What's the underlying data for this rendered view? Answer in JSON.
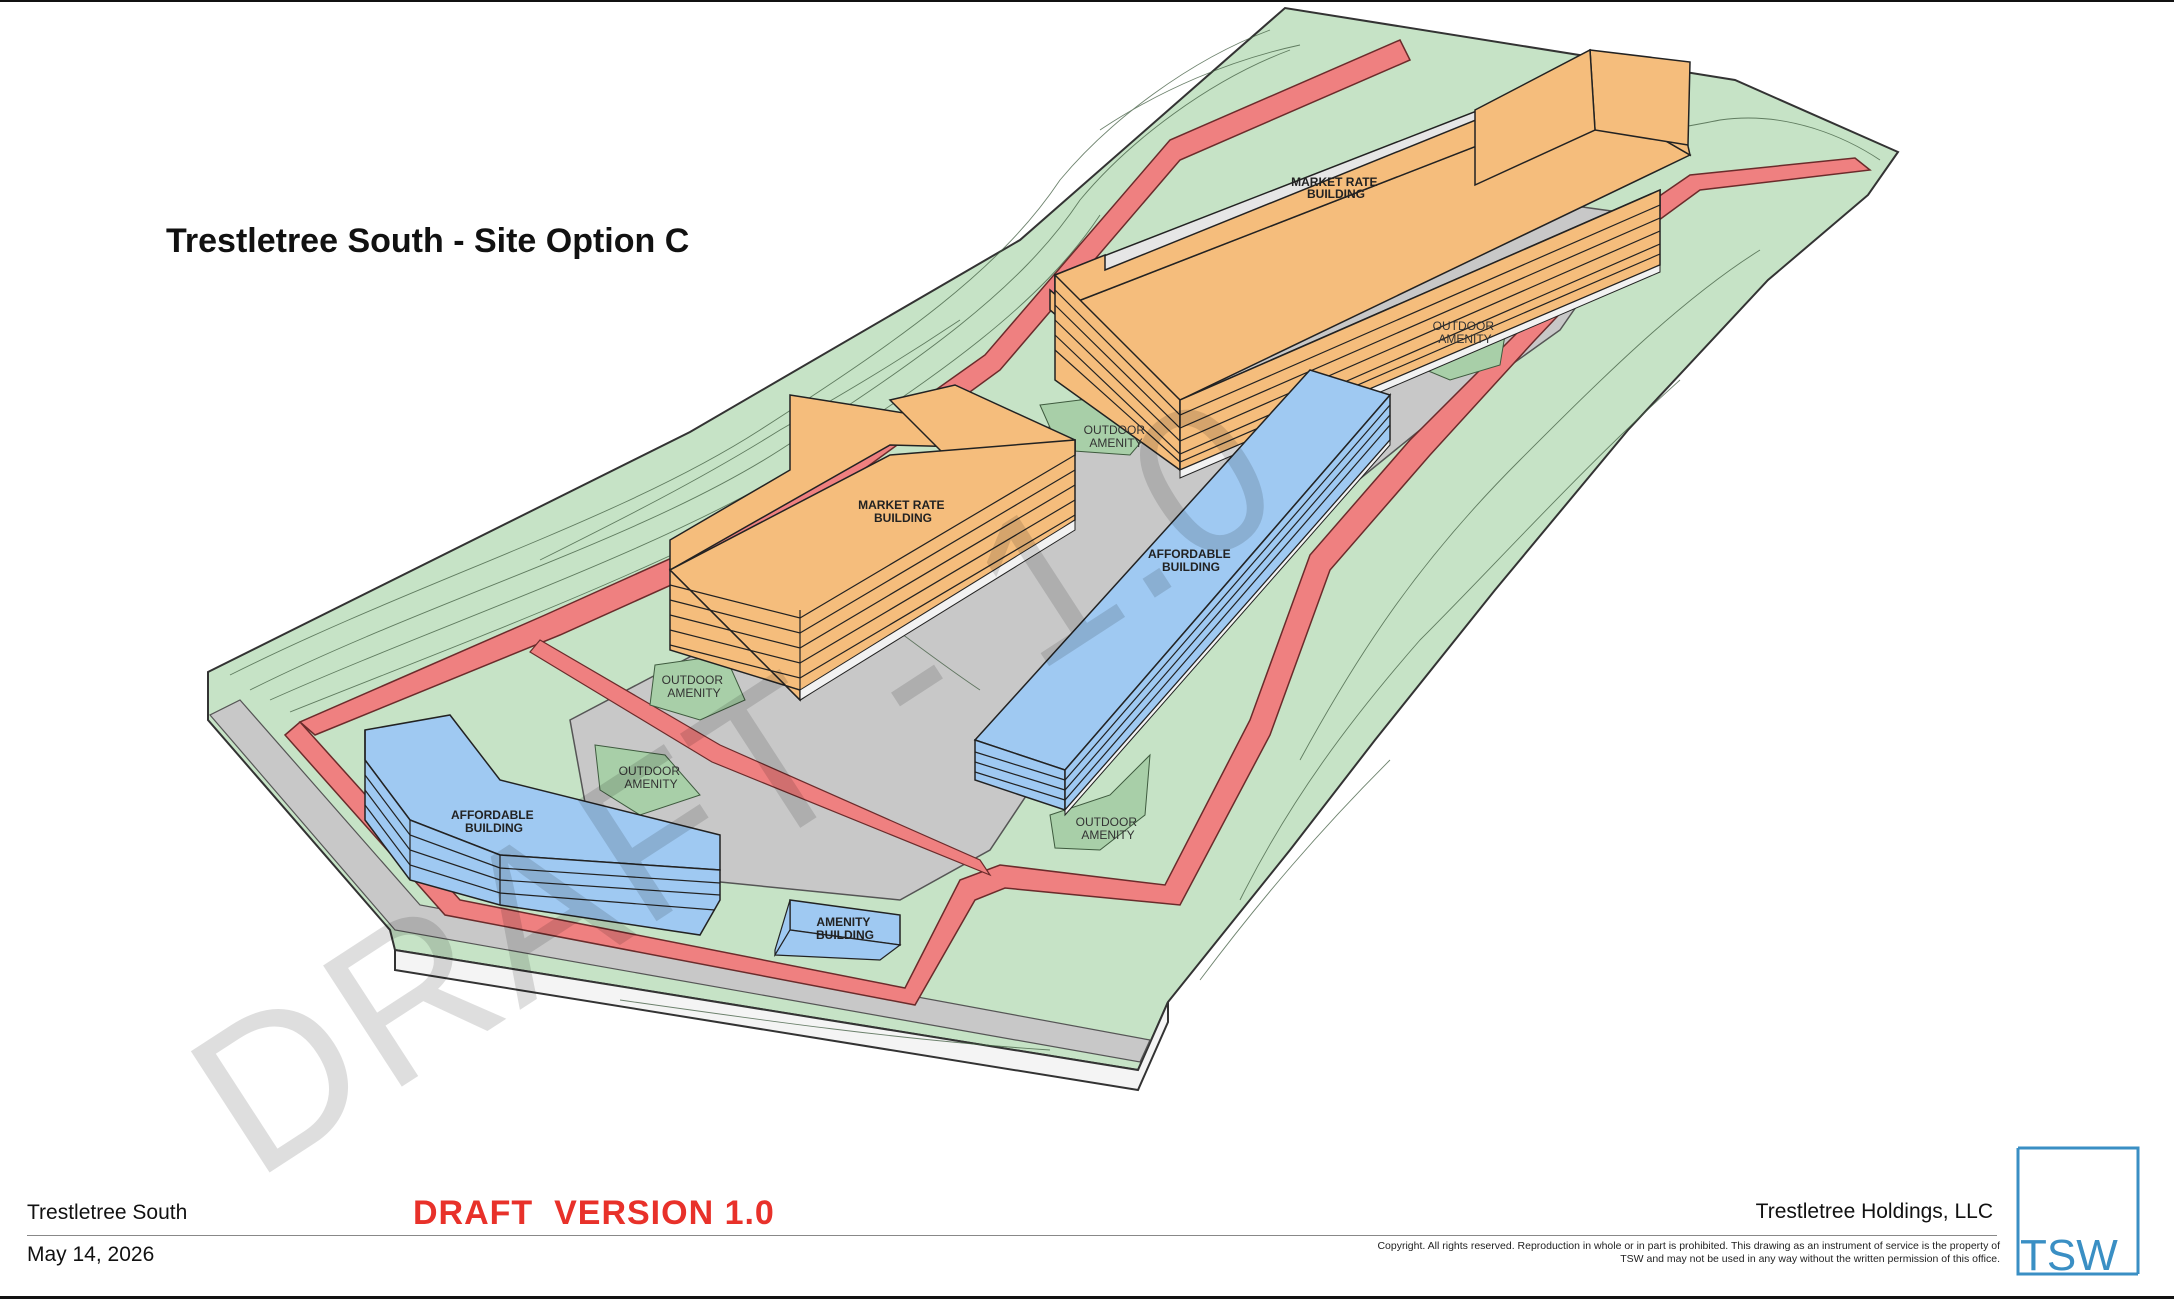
{
  "title": "Trestletree South - Site Option C",
  "watermark": "DRAFT - 1.0",
  "labels": {
    "market_rate_1": [
      "MARKET RATE",
      "BUILDING"
    ],
    "market_rate_2": [
      "MARKET RATE",
      "BUILDING"
    ],
    "affordable_1": [
      "AFFORDABLE",
      "BUILDING"
    ],
    "affordable_2": [
      "AFFORDABLE",
      "BUILDING"
    ],
    "amenity_building": [
      "AMENITY",
      "BUILDING"
    ],
    "outdoor_amenity": [
      "OUTDOOR",
      "AMENITY"
    ]
  },
  "title_block": {
    "project": "Trestletree South",
    "date": "May 14, 2026",
    "draft": "DRAFT  VERSION 1.0",
    "client": "Trestletree Holdings, LLC",
    "copyright": "Copyright. All rights reserved. Reproduction in whole or in part is prohibited. This drawing as an instrument of service is the property of TSW and may not be used in any way without the written permission of this office.",
    "logo": "TSW"
  },
  "colors": {
    "market_rate": "#f5bd7c",
    "affordable": "#9fc9f2",
    "landscape": "#c6e3c6",
    "setback": "#ef8080",
    "paving": "#c8c8c8",
    "draft_red": "#e8312a",
    "logo_blue": "#3a8fc4"
  }
}
